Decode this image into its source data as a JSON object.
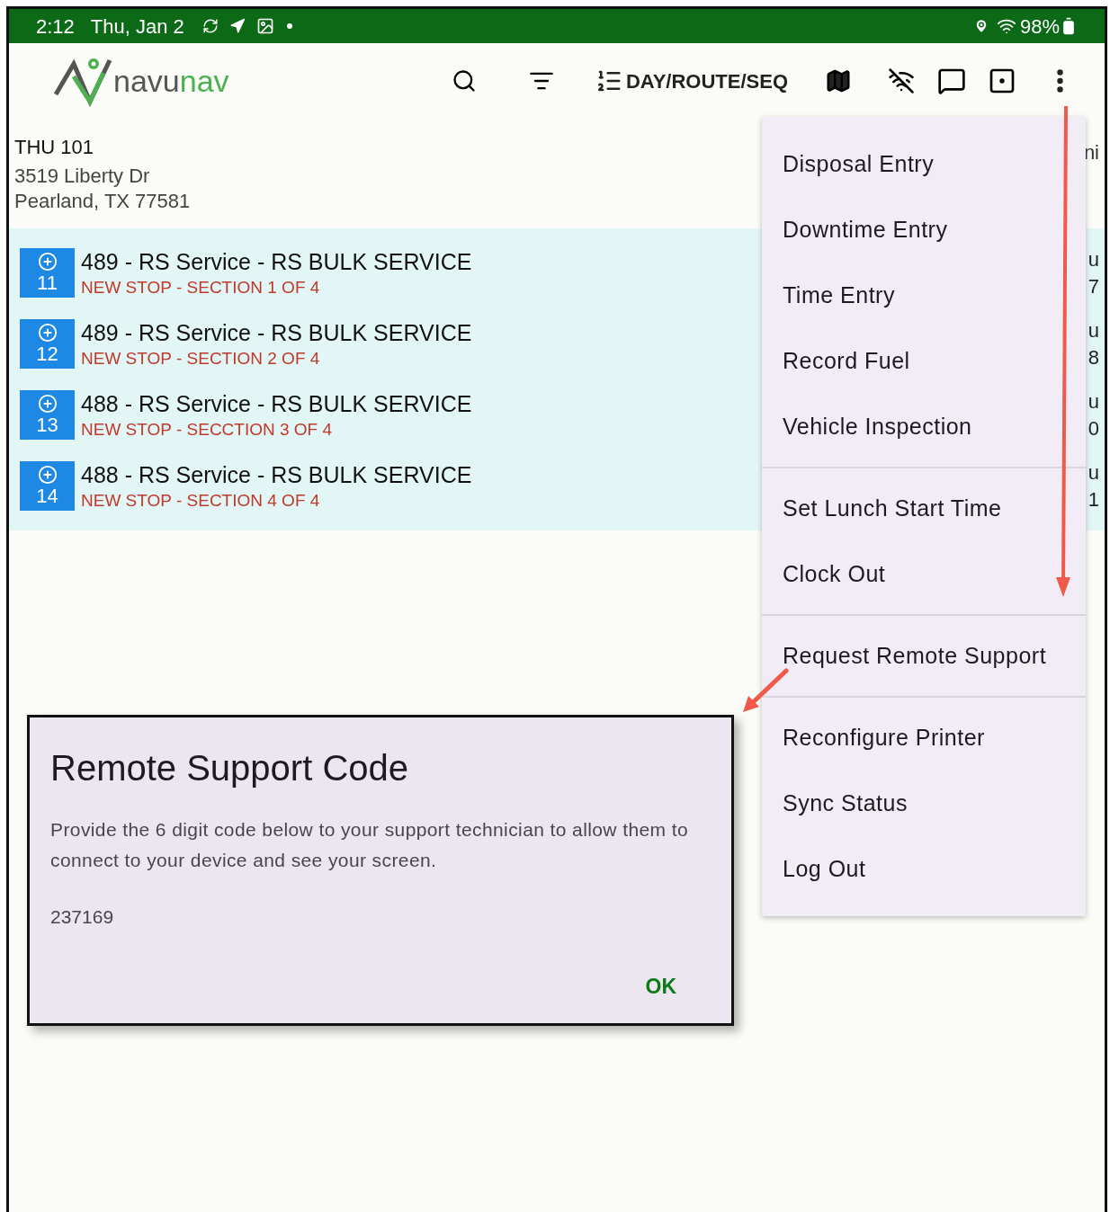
{
  "status_bar": {
    "time": "2:12",
    "date": "Thu, Jan 2",
    "battery": "98%"
  },
  "app_bar": {
    "logo": {
      "part_1": "navu",
      "part_2": "nav"
    },
    "sort_label": "DAY/ROUTE/SEQ"
  },
  "route": {
    "title": "THU 101",
    "address_1": "3519 Liberty Dr",
    "address_2": "Pearland, TX 77581",
    "right_cut": "ni"
  },
  "stops": [
    {
      "seq": "11",
      "title": "489 - RS Service - RS BULK SERVICE",
      "subtitle": "NEW STOP - SECTION 1 OF 4",
      "cut_1": "u",
      "cut_2": "7"
    },
    {
      "seq": "12",
      "title": "489 - RS Service - RS BULK SERVICE",
      "subtitle": "NEW STOP - SECTION 2 OF 4",
      "cut_1": "u",
      "cut_2": "8"
    },
    {
      "seq": "13",
      "title": "488 - RS Service - RS BULK SERVICE",
      "subtitle": "NEW STOP - SECCTION 3 OF 4",
      "cut_1": "u",
      "cut_2": "0"
    },
    {
      "seq": "14",
      "title": "488 - RS Service - RS BULK SERVICE",
      "subtitle": "NEW STOP - SECTION 4 OF 4",
      "cut_1": "u",
      "cut_2": "1"
    }
  ],
  "menu": [
    {
      "label": "Disposal Entry",
      "divider_before": false
    },
    {
      "label": "Downtime Entry",
      "divider_before": false
    },
    {
      "label": "Time Entry",
      "divider_before": false
    },
    {
      "label": "Record Fuel",
      "divider_before": false
    },
    {
      "label": "Vehicle Inspection",
      "divider_before": false
    },
    {
      "label": "Set Lunch Start Time",
      "divider_before": true
    },
    {
      "label": "Clock Out",
      "divider_before": false
    },
    {
      "label": "Request Remote Support",
      "divider_before": true
    },
    {
      "label": "Reconfigure Printer",
      "divider_before": true
    },
    {
      "label": "Sync Status",
      "divider_before": false
    },
    {
      "label": "Log Out",
      "divider_before": false
    }
  ],
  "dialog": {
    "title": "Remote Support Code",
    "message": "Provide the 6 digit code below to your support technician to allow them to connect to your device and see your screen.",
    "code": "237169",
    "ok_button": "OK"
  }
}
